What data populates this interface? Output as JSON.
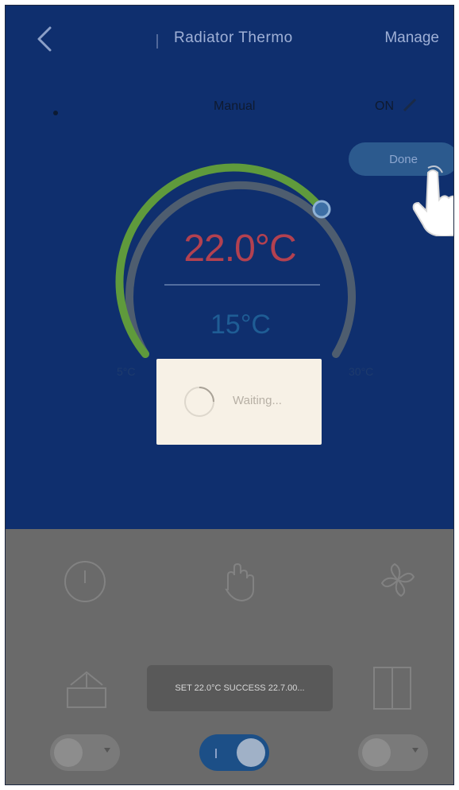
{
  "header": {
    "title": "Radiator Thermo",
    "manage_label": "Manage"
  },
  "status": {
    "mode_label": "Manual",
    "state_label": "ON"
  },
  "pill_button_label": "Done",
  "dial": {
    "current_temp": "22.0°C",
    "set_temp": "15°C",
    "min_label": "5°C",
    "max_label": "30°C"
  },
  "waiting_dialog": {
    "text": "Waiting..."
  },
  "bottom_controls": {
    "icons": [
      "power-icon",
      "hand-icon",
      "fan-icon",
      "window-icon",
      "door-icon"
    ],
    "system_toast": "SET 22.0°C SUCCESS 22.7.00..."
  },
  "toggles": [
    {
      "name": "toggle-left",
      "state": "off"
    },
    {
      "name": "toggle-middle",
      "state": "on"
    },
    {
      "name": "toggle-right",
      "state": "off"
    }
  ],
  "colors": {
    "panel_bg": "#0f2f6e",
    "overlay_gray": "#6a6a6a",
    "arc_green": "#5f9a3c",
    "accent_blue": "#1f5d95",
    "temp_red": "#b34150"
  }
}
